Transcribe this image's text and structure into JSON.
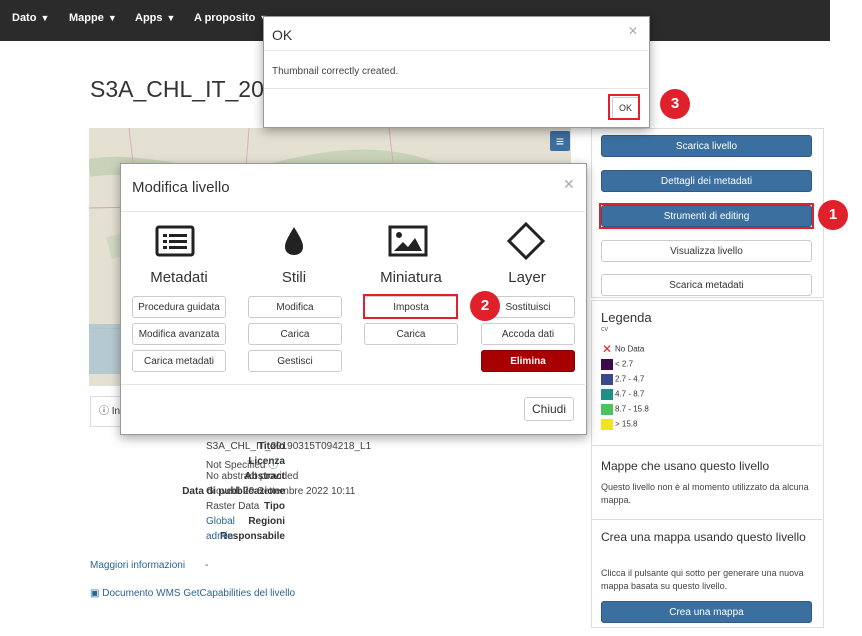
{
  "nav": {
    "items": [
      "Dato",
      "Mappe",
      "Apps",
      "A proposito"
    ]
  },
  "page": {
    "title": "S3A_CHL_IT_2019"
  },
  "tabs": {
    "info": "Info"
  },
  "info": {
    "rows": [
      {
        "label": "Titolo",
        "value": "S3A_CHL_IT_20190315T094218_L1"
      },
      {
        "label": "Licenza",
        "value": "Not Specified"
      },
      {
        "label": "Abstract",
        "value": "No abstract provided"
      },
      {
        "label": "Data di pubblicazione",
        "value": "Giovedì 29 Settembre 2022 10:11"
      },
      {
        "label": "Tipo",
        "value": "Raster Data"
      },
      {
        "label": "Regioni",
        "value": "Global"
      },
      {
        "label": "Responsabile",
        "value": "admin"
      }
    ],
    "more_info_label": "Maggiori informazioni",
    "more_info_value": "-",
    "wms_link": "Documento WMS GetCapabilities del livello"
  },
  "sidebar": {
    "buttons": {
      "scarica_livello": "Scarica livello",
      "dettagli_metadati": "Dettagli dei metadati",
      "strumenti_editing": "Strumenti di editing",
      "visualizza_livello": "Visualizza livello",
      "scarica_metadati": "Scarica metadati"
    },
    "legend": {
      "title": "Legenda",
      "subtitle": "cv",
      "items": [
        {
          "label": "No Data",
          "color": "#ffffff"
        },
        {
          "label": "< 2.7",
          "color": "#3d0a52"
        },
        {
          "label": "2.7 - 4.7",
          "color": "#3b4a8c"
        },
        {
          "label": "4.7 - 8.7",
          "color": "#1f8f8a"
        },
        {
          "label": "8.7 - 15.8",
          "color": "#4cc261"
        },
        {
          "label": "> 15.8",
          "color": "#f2e51a"
        }
      ]
    },
    "maps_heading": "Mappe che usano questo livello",
    "maps_text": "Questo livello non è al momento utilizzato da alcuna mappa.",
    "create_heading": "Crea una mappa usando questo livello",
    "create_text": "Clicca il pulsante qui sotto per generare una nuova mappa basata su questo livello.",
    "create_button": "Crea una mappa"
  },
  "modal": {
    "title": "Modifica livello",
    "columns": [
      {
        "heading": "Metadati",
        "icon": "list-icon",
        "buttons": [
          "Procedura guidata",
          "Modifica avanzata",
          "Carica metadati"
        ]
      },
      {
        "heading": "Stili",
        "icon": "droplet-icon",
        "buttons": [
          "Modifica",
          "Carica",
          "Gestisci"
        ]
      },
      {
        "heading": "Miniatura",
        "icon": "image-icon",
        "buttons": [
          "Imposta",
          "Carica"
        ]
      },
      {
        "heading": "Layer",
        "icon": "diamond-icon",
        "buttons": [
          "Sostituisci",
          "Accoda dati",
          "Elimina"
        ]
      }
    ],
    "close_label": "Chiudi"
  },
  "ok_dialog": {
    "title": "OK",
    "message": "Thumbnail correctly created.",
    "ok_label": "OK"
  },
  "annotations": [
    "1",
    "2",
    "3"
  ],
  "colors": {
    "accent_blue": "#3a6fa0",
    "danger_red": "#a80000",
    "highlight_red": "#e0212b"
  }
}
